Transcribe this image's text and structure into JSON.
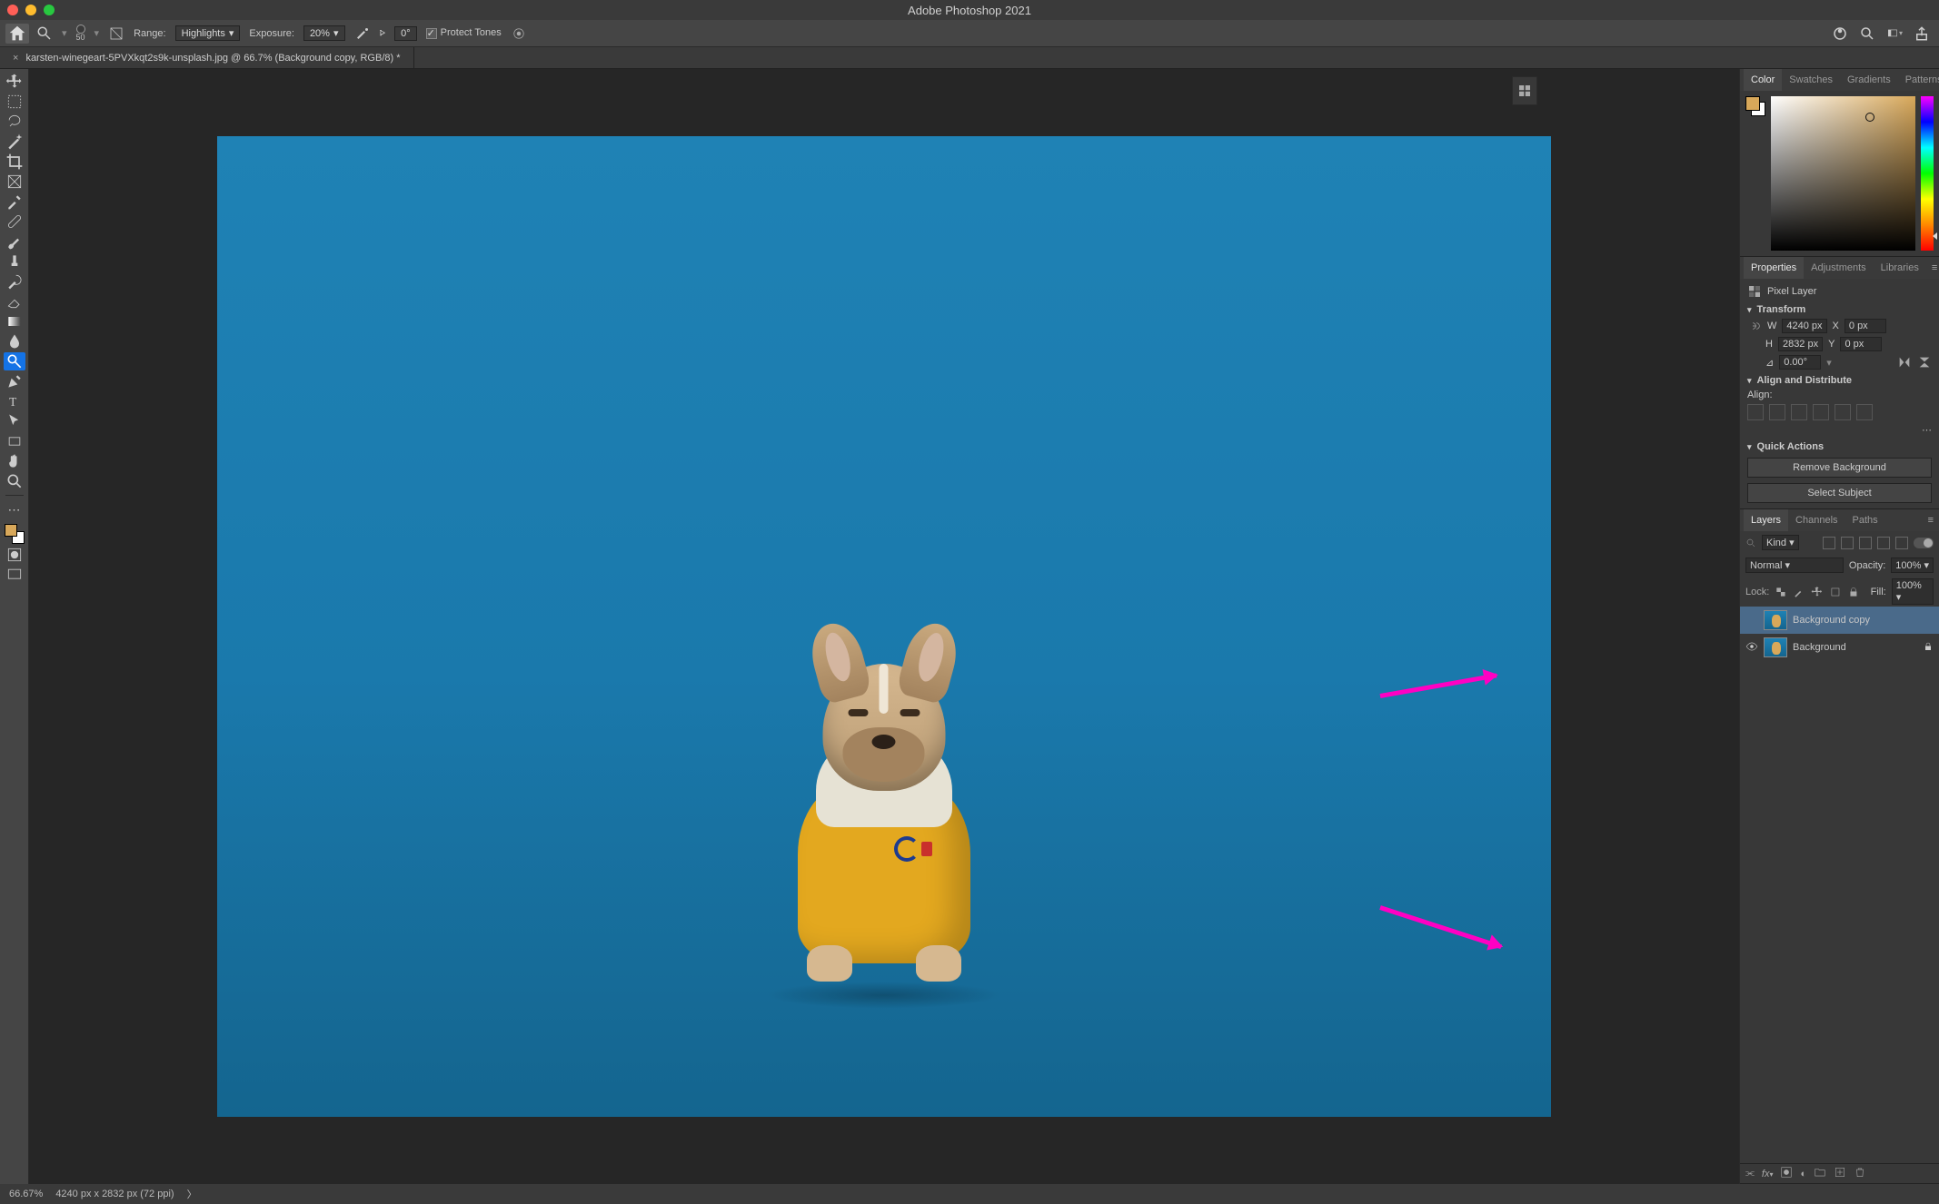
{
  "app_title": "Adobe Photoshop 2021",
  "options": {
    "brush_size": "50",
    "range_label": "Range:",
    "range_value": "Highlights",
    "exposure_label": "Exposure:",
    "exposure_value": "20%",
    "angle_symbol": "⦠",
    "angle_value": "0°",
    "protect_tones_label": "Protect Tones"
  },
  "doc_tab": "karsten-winegeart-5PVXkqt2s9k-unsplash.jpg @ 66.7% (Background copy, RGB/8) *",
  "tools": [
    "move",
    "marquee",
    "lasso",
    "quick-select",
    "crop",
    "frame",
    "eyedropper",
    "heal",
    "brush",
    "stamp",
    "history-brush",
    "eraser",
    "gradient",
    "blur",
    "dodge",
    "pen",
    "text",
    "path-select",
    "shape",
    "hand",
    "zoom"
  ],
  "color_panel": {
    "tabs": [
      "Color",
      "Swatches",
      "Gradients",
      "Patterns"
    ],
    "active": 0
  },
  "props_panel": {
    "tabs": [
      "Properties",
      "Adjustments",
      "Libraries"
    ],
    "active": 0,
    "layer_kind_label": "Pixel Layer",
    "transform_label": "Transform",
    "W_label": "W",
    "W_value": "4240 px",
    "H_label": "H",
    "H_value": "2832 px",
    "X_label": "X",
    "X_value": "0 px",
    "Y_label": "Y",
    "Y_value": "0 px",
    "angle_value": "0.00°",
    "align_label": "Align and Distribute",
    "align_sub": "Align:",
    "quick_label": "Quick Actions",
    "btn_remove_bg": "Remove Background",
    "btn_select_subject": "Select Subject"
  },
  "layers_panel": {
    "tabs": [
      "Layers",
      "Channels",
      "Paths"
    ],
    "active": 0,
    "filter_kind": "Kind",
    "blend_mode": "Normal",
    "opacity_label": "Opacity:",
    "opacity_value": "100%",
    "lock_label": "Lock:",
    "fill_label": "Fill:",
    "fill_value": "100%",
    "layers": [
      {
        "name": "Background copy",
        "visible": false,
        "selected": true,
        "locked": false
      },
      {
        "name": "Background",
        "visible": true,
        "selected": false,
        "locked": true
      }
    ]
  },
  "status": {
    "zoom": "66.67%",
    "dims": "4240 px x 2832 px (72 ppi)"
  }
}
